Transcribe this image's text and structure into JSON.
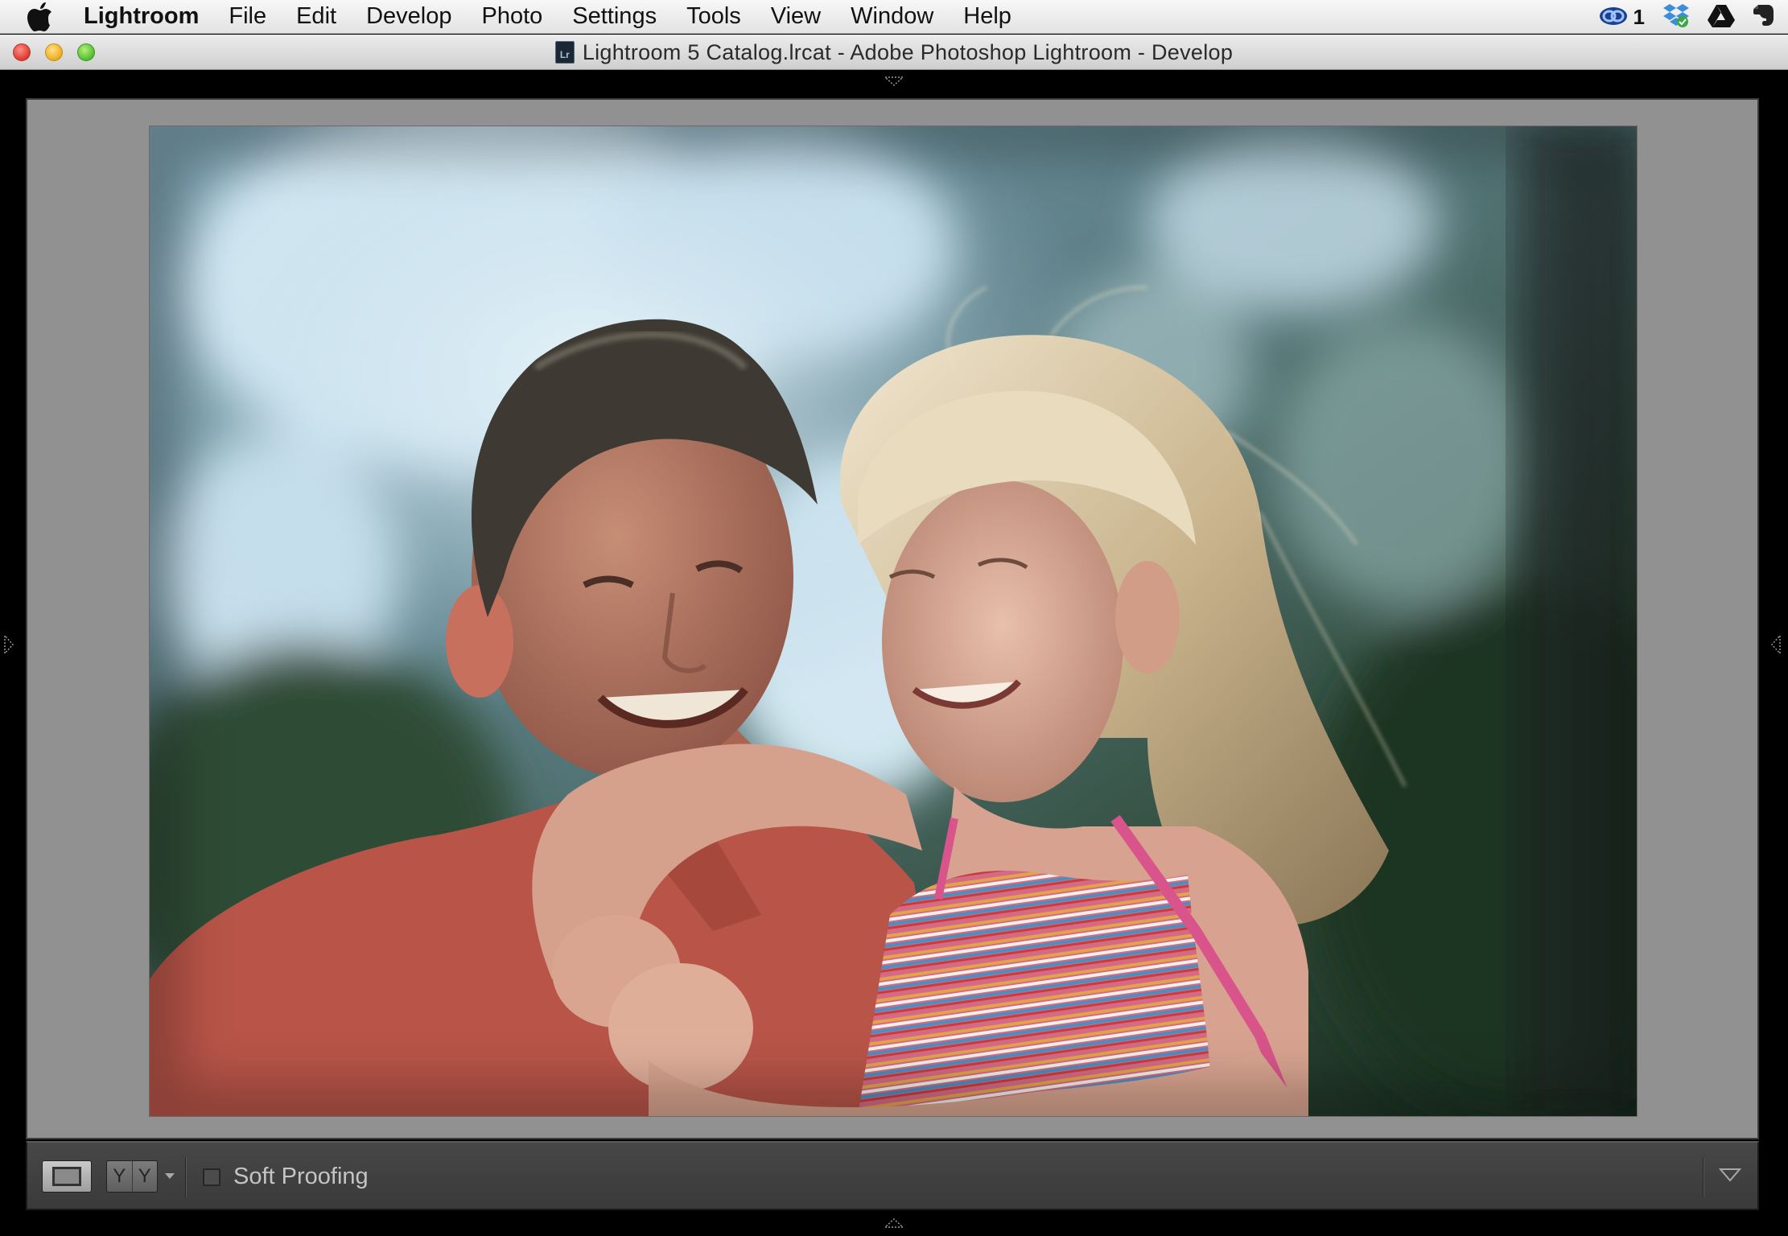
{
  "menubar": {
    "app_name": "Lightroom",
    "items": [
      "File",
      "Edit",
      "Develop",
      "Photo",
      "Settings",
      "Tools",
      "View",
      "Window",
      "Help"
    ],
    "status_icons": [
      "creative-cloud-icon",
      "dropbox-icon",
      "google-drive-icon",
      "evernote-icon"
    ],
    "notification_count": "1"
  },
  "window": {
    "title": "Lightroom 5 Catalog.lrcat - Adobe Photoshop Lightroom - Develop",
    "buttons": [
      "close",
      "minimize",
      "zoom"
    ]
  },
  "photo": {
    "description_icon": "photo-canvas"
  },
  "toolbar": {
    "view_mode": "loupe",
    "compare_label_a": "Y",
    "compare_label_b": "Y",
    "soft_proofing_label": "Soft Proofing",
    "soft_proofing_checked": false
  },
  "colors": {
    "canvas_background": "#919191",
    "toolbar_background": "#404040",
    "menubar_background": "#ececec"
  }
}
